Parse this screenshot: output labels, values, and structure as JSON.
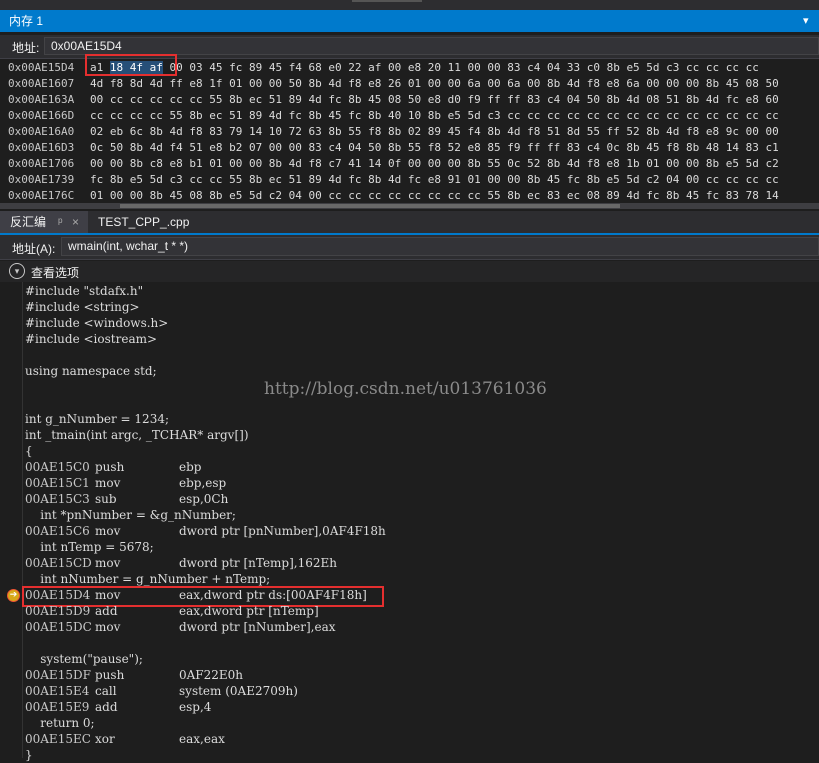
{
  "memory_window": {
    "title": "内存 1",
    "address_label": "地址:",
    "address_value": "0x00AE15D4",
    "rows": [
      {
        "addr": "0x00AE15D4",
        "first": "a1 ",
        "sel": "18 4f af",
        "rest": " 00 03 45 fc 89 45 f4 68 e0 22 af 00 e8 20 11 00 00 83 c4 04 33 c0 8b e5 5d c3 cc cc cc cc"
      },
      {
        "addr": "0x00AE1607",
        "first": "",
        "sel": "",
        "rest": "4d f8 8d 4d ff e8 1f 01 00 00 50 8b 4d f8 e8 26 01 00 00 6a 00 6a 00 8b 4d f8 e8 6a 00 00 00 8b 45 08 50"
      },
      {
        "addr": "0x00AE163A",
        "first": "",
        "sel": "",
        "rest": "00 cc cc cc cc cc 55 8b ec 51 89 4d fc 8b 45 08 50 e8 d0 f9 ff ff 83 c4 04 50 8b 4d 08 51 8b 4d fc e8 60"
      },
      {
        "addr": "0x00AE166D",
        "first": "",
        "sel": "",
        "rest": "cc cc cc cc 55 8b ec 51 89 4d fc 8b 45 fc 8b 40 10 8b e5 5d c3 cc cc cc cc cc cc cc cc cc cc cc cc cc cc"
      },
      {
        "addr": "0x00AE16A0",
        "first": "",
        "sel": "",
        "rest": "02 eb 6c 8b 4d f8 83 79 14 10 72 63 8b 55 f8 8b 02 89 45 f4 8b 4d f8 51 8d 55 ff 52 8b 4d f8 e8 9c 00 00"
      },
      {
        "addr": "0x00AE16D3",
        "first": "",
        "sel": "",
        "rest": "0c 50 8b 4d f4 51 e8 b2 07 00 00 83 c4 04 50 8b 55 f8 52 e8 85 f9 ff ff 83 c4 0c 8b 45 f8 8b 48 14 83 c1"
      },
      {
        "addr": "0x00AE1706",
        "first": "",
        "sel": "",
        "rest": "00 00 8b c8 e8 b1 01 00 00 8b 4d f8 c7 41 14 0f 00 00 00 8b 55 0c 52 8b 4d f8 e8 1b 01 00 00 8b e5 5d c2"
      },
      {
        "addr": "0x00AE1739",
        "first": "",
        "sel": "",
        "rest": "fc 8b e5 5d c3 cc cc 55 8b ec 51 89 4d fc 8b 4d fc e8 91 01 00 00 8b 45 fc 8b e5 5d c2 04 00 cc cc cc cc"
      },
      {
        "addr": "0x00AE176C",
        "first": "",
        "sel": "",
        "rest": "01 00 00 8b 45 08 8b e5 5d c2 04 00 cc cc cc cc cc cc cc cc 55 8b ec 83 ec 08 89 4d fc 8b 45 fc 83 78 14"
      }
    ]
  },
  "disasm_tabs": {
    "tab1_label": "反汇编",
    "tab1_pin": "ᵖ",
    "tab1_close": "×",
    "tab2_label": "TEST_CPP_.cpp"
  },
  "disasm": {
    "address_label": "地址(A):",
    "address_value": "wmain(int, wchar_t * *)",
    "view_options_label": "查看选项",
    "watermark": "http://blog.csdn.net/u013761036"
  },
  "code_lines": [
    {
      "addr": "",
      "mn": "",
      "op": "",
      "src": "#include \"stdafx.h\""
    },
    {
      "addr": "",
      "mn": "",
      "op": "",
      "src": "#include <string>"
    },
    {
      "addr": "",
      "mn": "",
      "op": "",
      "src": "#include <windows.h>"
    },
    {
      "addr": "",
      "mn": "",
      "op": "",
      "src": "#include <iostream>"
    },
    {
      "addr": "",
      "mn": "",
      "op": "",
      "src": ""
    },
    {
      "addr": "",
      "mn": "",
      "op": "",
      "src": "using namespace std;"
    },
    {
      "addr": "",
      "mn": "",
      "op": "",
      "src": ""
    },
    {
      "addr": "",
      "mn": "",
      "op": "",
      "src": ""
    },
    {
      "addr": "",
      "mn": "",
      "op": "",
      "src": "int g_nNumber = 1234;"
    },
    {
      "addr": "",
      "mn": "",
      "op": "",
      "src": "int _tmain(int argc, _TCHAR* argv[])"
    },
    {
      "addr": "",
      "mn": "",
      "op": "",
      "src": "{"
    },
    {
      "addr": "00AE15C0",
      "mn": "push",
      "op": "ebp",
      "src": ""
    },
    {
      "addr": "00AE15C1",
      "mn": "mov",
      "op": "ebp,esp",
      "src": ""
    },
    {
      "addr": "00AE15C3",
      "mn": "sub",
      "op": "esp,0Ch",
      "src": ""
    },
    {
      "addr": "",
      "mn": "",
      "op": "",
      "src": "    int *pnNumber = &g_nNumber;"
    },
    {
      "addr": "00AE15C6",
      "mn": "mov",
      "op": "dword ptr [pnNumber],0AF4F18h",
      "src": ""
    },
    {
      "addr": "",
      "mn": "",
      "op": "",
      "src": "    int nTemp = 5678;"
    },
    {
      "addr": "00AE15CD",
      "mn": "mov",
      "op": "dword ptr [nTemp],162Eh",
      "src": ""
    },
    {
      "addr": "",
      "mn": "",
      "op": "",
      "src": "    int nNumber = g_nNumber + nTemp;"
    },
    {
      "addr": "00AE15D4",
      "mn": "mov",
      "op": "eax,dword ptr ds:[00AF4F18h]",
      "src": ""
    },
    {
      "addr": "00AE15D9",
      "mn": "add",
      "op": "eax,dword ptr [nTemp]",
      "src": ""
    },
    {
      "addr": "00AE15DC",
      "mn": "mov",
      "op": "dword ptr [nNumber],eax",
      "src": ""
    },
    {
      "addr": "",
      "mn": "",
      "op": "",
      "src": ""
    },
    {
      "addr": "",
      "mn": "",
      "op": "",
      "src": "    system(\"pause\");"
    },
    {
      "addr": "00AE15DF",
      "mn": "push",
      "op": "0AF22E0h",
      "src": ""
    },
    {
      "addr": "00AE15E4",
      "mn": "call",
      "op": "system (0AE2709h)",
      "src": ""
    },
    {
      "addr": "00AE15E9",
      "mn": "add",
      "op": "esp,4",
      "src": ""
    },
    {
      "addr": "",
      "mn": "",
      "op": "",
      "src": "    return 0;"
    },
    {
      "addr": "00AE15EC",
      "mn": "xor",
      "op": "eax,eax",
      "src": ""
    },
    {
      "addr": "",
      "mn": "",
      "op": "",
      "src": "}"
    }
  ],
  "colors": {
    "title_bar": "#007acc",
    "highlight_box": "#e52f2f",
    "selection": "#264f78",
    "current_line_marker": "#d7a81a"
  }
}
